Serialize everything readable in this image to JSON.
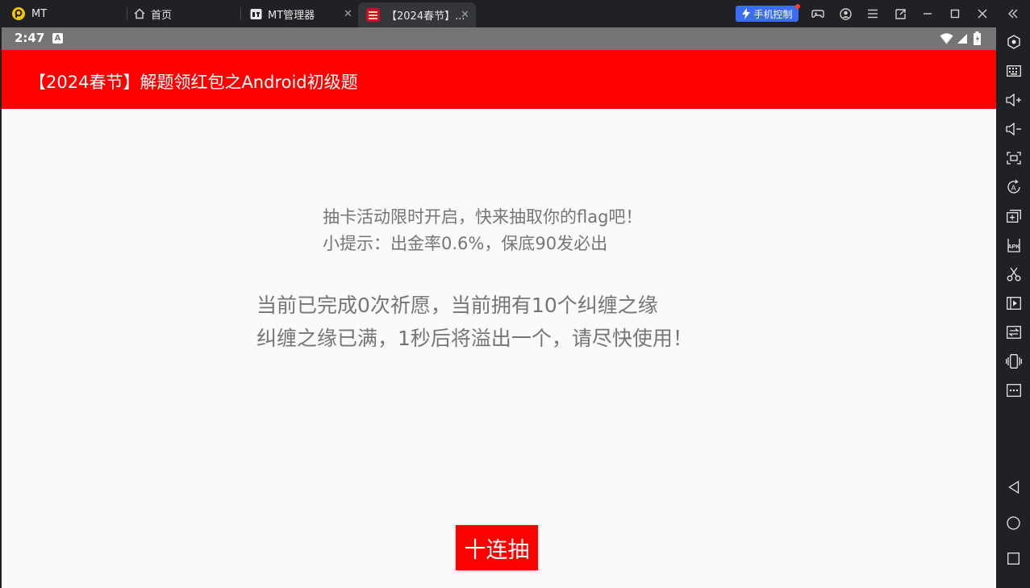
{
  "browser": {
    "tabs": [
      {
        "label": "MT",
        "icon": "mt-logo-icon"
      },
      {
        "label": "首页",
        "icon": "home-icon"
      },
      {
        "label": "MT管理器",
        "icon": "mt-manager-icon",
        "closable": true
      },
      {
        "label": "【2024春节】...",
        "icon": "app-icon",
        "closable": true,
        "active": true
      }
    ],
    "phone_control_label": "手机控制"
  },
  "statusbar": {
    "time": "2:47",
    "notification_icon": "a-icon"
  },
  "app": {
    "title": "【2024春节】解题领红包之Android初级题",
    "intro_line1": "抽卡活动限时开启，快来抽取你的flag吧！",
    "intro_line2": "小提示：出金率0.6%，保底90发必出",
    "status_line1": "当前已完成0次祈愿，当前拥有10个纠缠之缘",
    "status_line2": "纠缠之缘已满，1秒后将溢出一个，请尽快使用！",
    "draw_button_label": "十连抽"
  },
  "colors": {
    "accent": "#ff0000",
    "status_bar": "#757575",
    "phone_control": "#3b6cf5",
    "chrome": "#202124"
  },
  "sidebar_icons": [
    "settings-icon",
    "keyboard-icon",
    "volume-up-icon",
    "volume-down-icon",
    "screenshot-icon",
    "auto-rotate-icon",
    "add-window-icon",
    "apk-install-icon",
    "scissors-icon",
    "video-record-icon",
    "file-transfer-icon",
    "shake-icon",
    "more-icon",
    "back-icon",
    "home-circle-icon",
    "recents-icon"
  ]
}
